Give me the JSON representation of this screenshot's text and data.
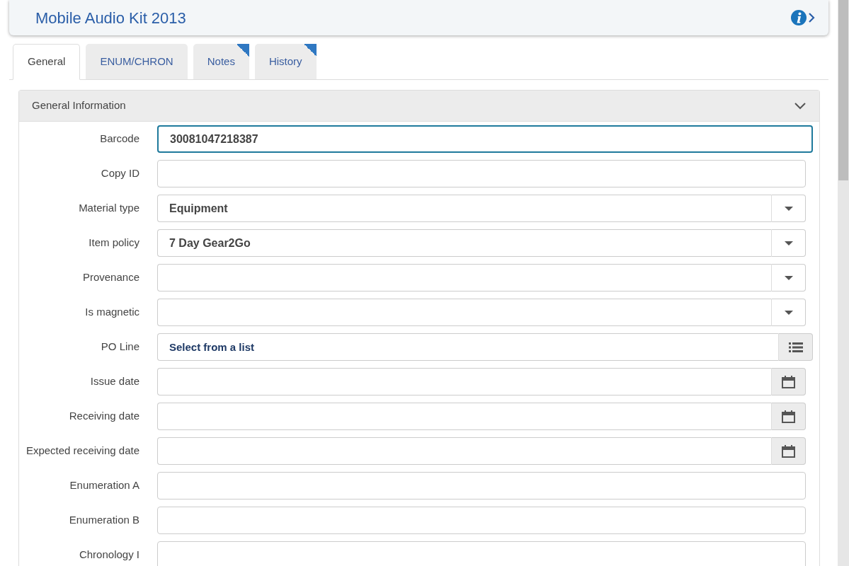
{
  "header": {
    "title": "Mobile Audio Kit 2013"
  },
  "tabs": [
    {
      "label": "General",
      "selected": true,
      "flagged": false
    },
    {
      "label": "ENUM/CHRON",
      "selected": false,
      "flagged": false
    },
    {
      "label": "Notes",
      "selected": false,
      "flagged": true
    },
    {
      "label": "History",
      "selected": false,
      "flagged": true
    }
  ],
  "panel": {
    "title": "General Information",
    "expanded": true
  },
  "fields": [
    {
      "label": "Barcode",
      "kind": "text",
      "value": "30081047218387",
      "focused": true
    },
    {
      "label": "Copy ID",
      "kind": "text",
      "focused": false
    },
    {
      "label": "Material type",
      "kind": "select",
      "value": "Equipment",
      "focused": false
    },
    {
      "label": "Item policy",
      "kind": "select",
      "value": "7 Day Gear2Go",
      "focused": false
    },
    {
      "label": "Provenance",
      "kind": "select",
      "focused": false
    },
    {
      "label": "Is magnetic",
      "kind": "select",
      "focused": false
    },
    {
      "label": "PO Line",
      "kind": "list",
      "placeholder": "Select from a list",
      "focused": false
    },
    {
      "label": "Issue date",
      "kind": "date",
      "focused": false
    },
    {
      "label": "Receiving date",
      "kind": "date",
      "focused": false
    },
    {
      "label": "Expected receiving date",
      "kind": "date",
      "focused": false
    },
    {
      "label": "Enumeration A",
      "kind": "text",
      "focused": false
    },
    {
      "label": "Enumeration B",
      "kind": "text",
      "focused": false
    },
    {
      "label": "Chronology I",
      "kind": "text",
      "focused": false
    }
  ]
}
